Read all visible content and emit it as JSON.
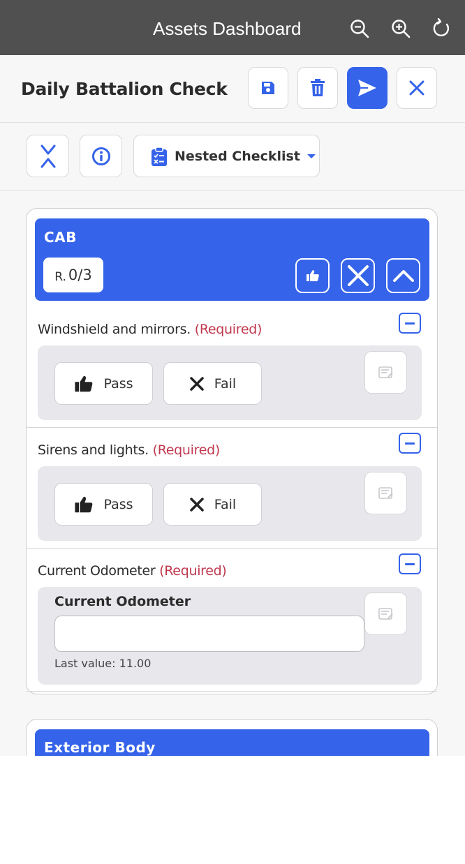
{
  "window": {
    "title": "Assets Dashboard",
    "icons": [
      "zoom-out-icon",
      "zoom-in-icon",
      "refresh-icon"
    ]
  },
  "header": {
    "title": "Daily Battalion Check",
    "buttons": [
      "save-icon",
      "trash-icon",
      "send-icon",
      "close-icon"
    ]
  },
  "toolbar": {
    "dropdown_label": "Nested Checklist",
    "icons": [
      "collapse-all-icon",
      "info-icon",
      "clipboard-checklist-icon"
    ]
  },
  "colors": {
    "primary": "#3563e9",
    "required": "#c0394f",
    "topbar": "#505050"
  },
  "sections": [
    {
      "title": "CAB",
      "required_prefix": "R.",
      "required_count": "0/3",
      "items": [
        {
          "label": "Windshield and mirrors.",
          "required": "(Required)",
          "pass_label": "Pass",
          "fail_label": "Fail"
        },
        {
          "label": "Sirens and lights.",
          "required": "(Required)",
          "pass_label": "Pass",
          "fail_label": "Fail"
        },
        {
          "label": "Current Odometer",
          "required": "(Required)",
          "field_label": "Current Odometer",
          "value": "",
          "last_value": "Last value: 11.00"
        }
      ]
    },
    {
      "title": "Exterior Body"
    }
  ]
}
